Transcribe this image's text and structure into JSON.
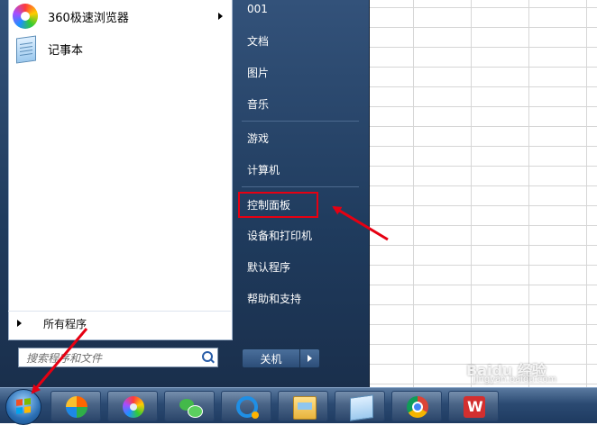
{
  "start_menu": {
    "left_pane": {
      "pinned": [
        {
          "label": "360极速浏览器",
          "icon": "browser-360-icon",
          "has_submenu": true
        },
        {
          "label": "记事本",
          "icon": "notepad-icon",
          "has_submenu": false
        }
      ],
      "all_programs_label": "所有程序",
      "search_placeholder": "搜索程序和文件"
    },
    "right_pane": {
      "items": [
        {
          "label": "001"
        },
        {
          "label": "文档"
        },
        {
          "label": "图片"
        },
        {
          "label": "音乐"
        },
        {
          "label": "游戏"
        },
        {
          "label": "计算机"
        },
        {
          "label": "控制面板"
        },
        {
          "label": "设备和打印机"
        },
        {
          "label": "默认程序"
        },
        {
          "label": "帮助和支持"
        }
      ],
      "shutdown_label": "关机"
    }
  },
  "taskbar": {
    "start_button": "windows-start-orb-icon",
    "pinned_apps": [
      {
        "icon": "petal-app-icon"
      },
      {
        "icon": "browser-360-icon"
      },
      {
        "icon": "wechat-icon"
      },
      {
        "icon": "qq-browser-icon"
      },
      {
        "icon": "file-explorer-icon"
      },
      {
        "icon": "notepad-icon"
      },
      {
        "icon": "chrome-icon"
      },
      {
        "icon": "wps-icon"
      }
    ]
  },
  "annotations": {
    "highlight_color": "#e60012",
    "highlighted_item": "控制面板"
  },
  "watermark": {
    "brand": "Baidu 经验",
    "url": "jingyan.baidu.com"
  }
}
